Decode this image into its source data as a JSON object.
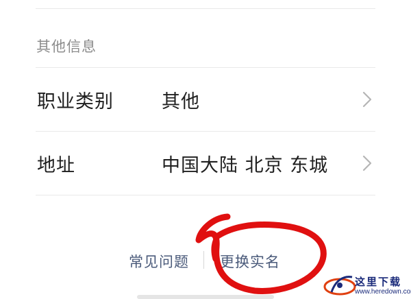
{
  "section": {
    "title": "其他信息"
  },
  "rows": [
    {
      "label": "职业类别",
      "value": "其他"
    },
    {
      "label": "地址",
      "value": "中国大陆 北京 东城"
    }
  ],
  "footer": {
    "faq": "常见问题",
    "change_name": "更换实名"
  },
  "annotation": {
    "color": "#e01010"
  },
  "watermark": {
    "name": "这里下载",
    "url": "www.heredown.com"
  },
  "colors": {
    "text": "#1f1f1f",
    "muted": "#8c8c8c",
    "link": "#4a5a7a",
    "divider": "#e9e9e9",
    "chevron": "#b5b5b5"
  }
}
